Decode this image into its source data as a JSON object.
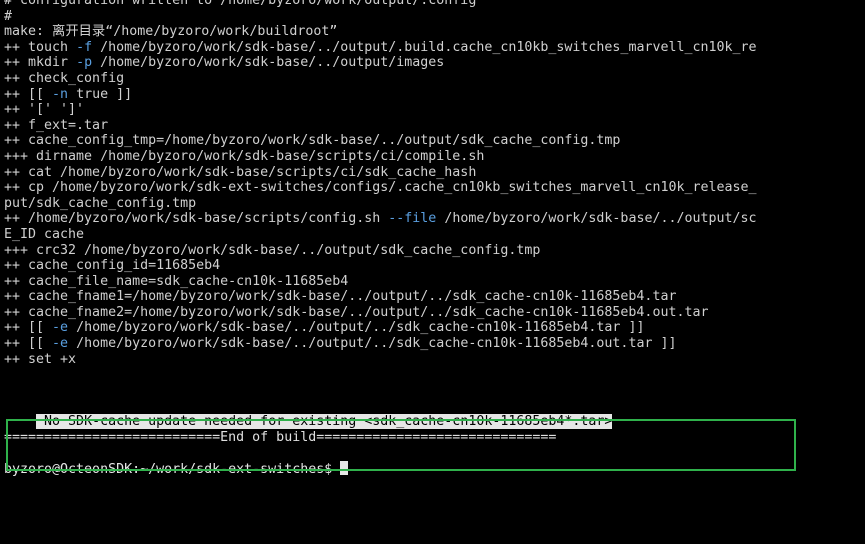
{
  "terminal": {
    "lines": [
      [
        {
          "t": "# configuration written to /home/byzoro/work/output/.config"
        }
      ],
      [
        {
          "t": "#"
        }
      ],
      [
        {
          "t": "make: 离开目录“/home/byzoro/work/buildroot”"
        }
      ],
      [
        {
          "t": "++ touch "
        },
        {
          "t": "-f",
          "c": "flag"
        },
        {
          "t": " /home/byzoro/work/sdk-base/../output/.build.cache_cn10kb_switches_marvell_cn10k_re"
        }
      ],
      [
        {
          "t": "++ mkdir "
        },
        {
          "t": "-p",
          "c": "flag"
        },
        {
          "t": " /home/byzoro/work/sdk-base/../output/images"
        }
      ],
      [
        {
          "t": "++ check_config"
        }
      ],
      [
        {
          "t": "++ [[ "
        },
        {
          "t": "-n",
          "c": "flag"
        },
        {
          "t": " true ]]"
        }
      ],
      [
        {
          "t": "++ '[' ']'"
        }
      ],
      [
        {
          "t": "++ f_ext=.tar"
        }
      ],
      [
        {
          "t": "++ cache_config_tmp=/home/byzoro/work/sdk-base/../output/sdk_cache_config.tmp"
        }
      ],
      [
        {
          "t": "+++ dirname /home/byzoro/work/sdk-base/scripts/ci/compile.sh"
        }
      ],
      [
        {
          "t": "++ cat /home/byzoro/work/sdk-base/scripts/ci/sdk_cache_hash"
        }
      ],
      [
        {
          "t": "++ cp /home/byzoro/work/sdk-ext-switches/configs/.cache_cn10kb_switches_marvell_cn10k_release_"
        }
      ],
      [
        {
          "t": "put/sdk_cache_config.tmp"
        }
      ],
      [
        {
          "t": "++ /home/byzoro/work/sdk-base/scripts/config.sh "
        },
        {
          "t": "--file",
          "c": "flag"
        },
        {
          "t": " /home/byzoro/work/sdk-base/../output/sc"
        }
      ],
      [
        {
          "t": "E_ID cache"
        }
      ],
      [
        {
          "t": "+++ crc32 /home/byzoro/work/sdk-base/../output/sdk_cache_config.tmp"
        }
      ],
      [
        {
          "t": "++ cache_config_id=11685eb4"
        }
      ],
      [
        {
          "t": "++ cache_file_name=sdk_cache-cn10k-11685eb4"
        }
      ],
      [
        {
          "t": "++ cache_fname1=/home/byzoro/work/sdk-base/../output/../sdk_cache-cn10k-11685eb4.tar"
        }
      ],
      [
        {
          "t": "++ cache_fname2=/home/byzoro/work/sdk-base/../output/../sdk_cache-cn10k-11685eb4.out.tar"
        }
      ],
      [
        {
          "t": "++ [[ "
        },
        {
          "t": "-e",
          "c": "flag"
        },
        {
          "t": " /home/byzoro/work/sdk-base/../output/../sdk_cache-cn10k-11685eb4.tar ]]"
        }
      ],
      [
        {
          "t": "++ [[ "
        },
        {
          "t": "-e",
          "c": "flag"
        },
        {
          "t": " /home/byzoro/work/sdk-base/../output/../sdk_cache-cn10k-11685eb4.out.tar ]]"
        }
      ],
      [
        {
          "t": "++ set +x"
        }
      ]
    ],
    "notice": " No SDK-cache update needed for existing <sdk_cache-cn10k-11685eb4*.tar>",
    "banner": "===========================End of build==============================",
    "prompt": "byzoro@OcteonSDK:~/work/sdk-ext-switches$ "
  },
  "colors": {
    "background": "#000000",
    "foreground": "#d0d0d0",
    "flag": "#5a9fe0",
    "highlight_box": "#2fb14b",
    "notice_bg": "#e6e6e6"
  }
}
